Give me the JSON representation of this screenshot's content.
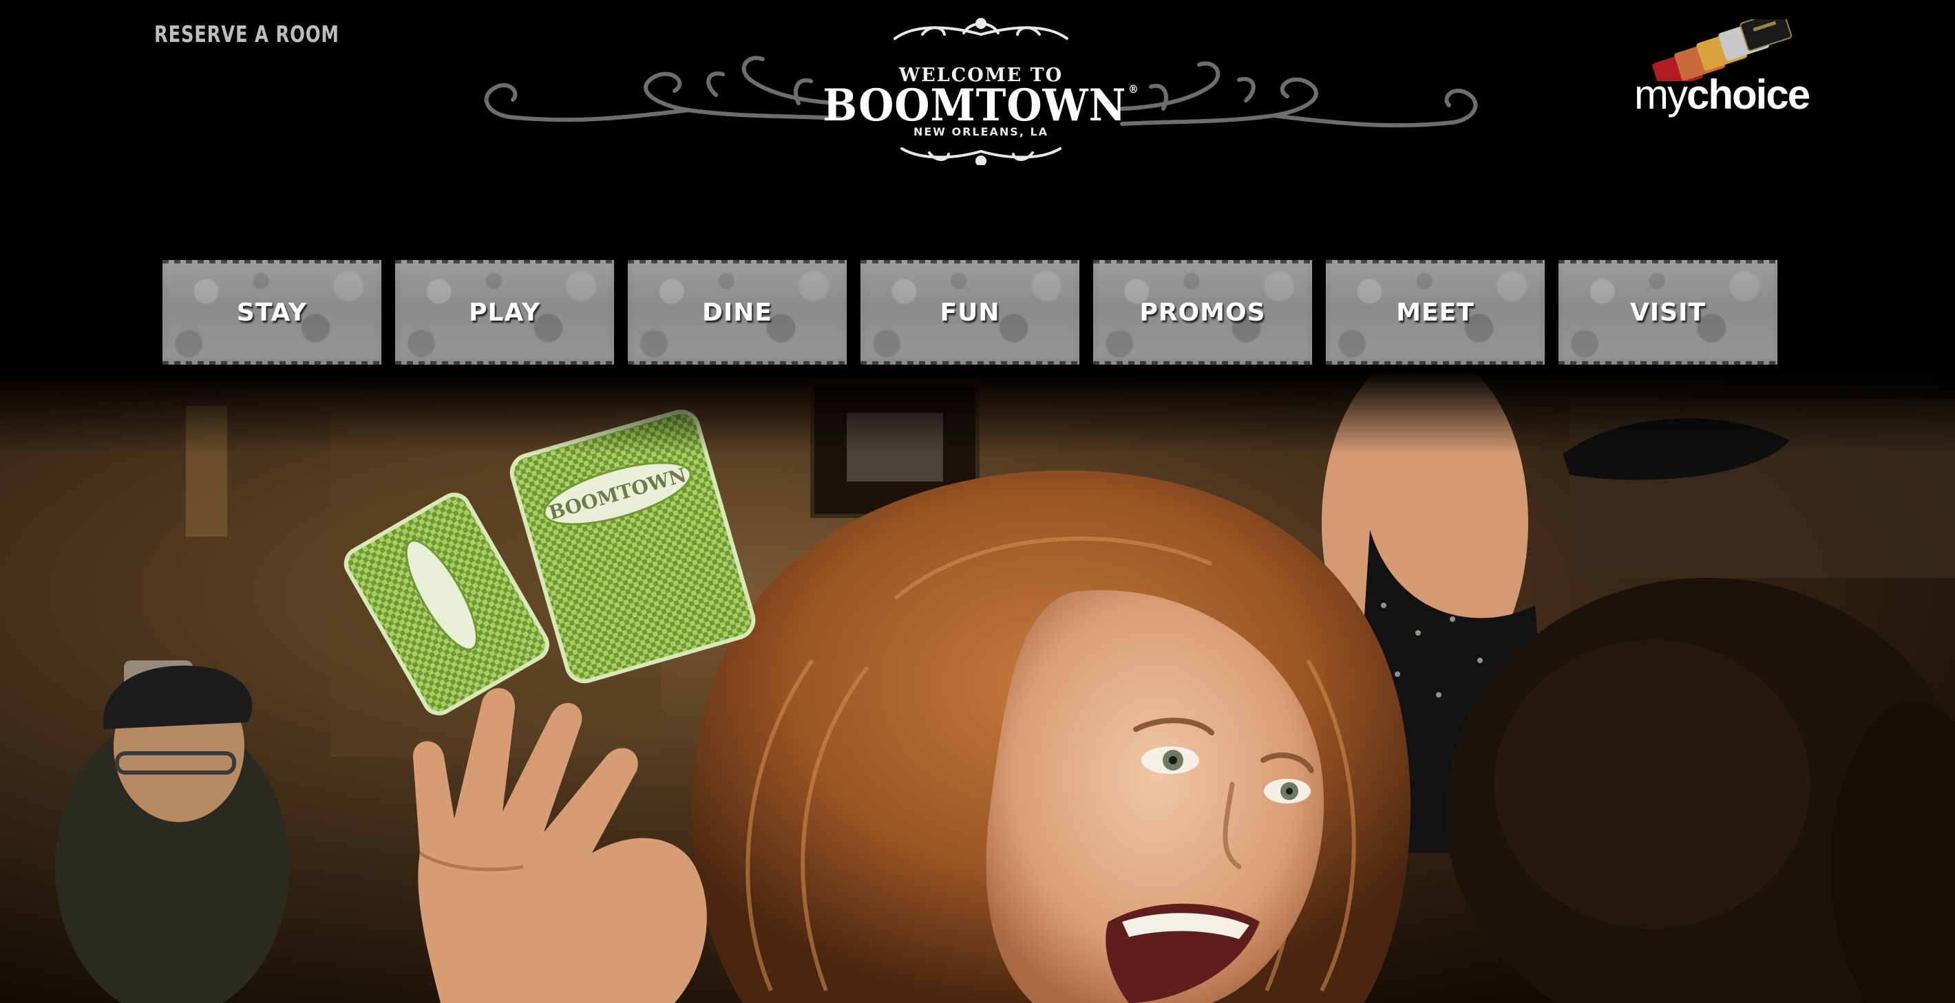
{
  "header": {
    "reserve_link": "RESERVE A ROOM",
    "brand": {
      "welcome": "WELCOME TO",
      "name": "BOOMTOWN",
      "registered": "®",
      "location": "NEW ORLEANS, LA"
    },
    "loyalty_logo": {
      "text_light": "my",
      "text_bold": "choice"
    }
  },
  "nav": {
    "items": [
      {
        "label": "STAY"
      },
      {
        "label": "PLAY"
      },
      {
        "label": "DINE"
      },
      {
        "label": "FUN"
      },
      {
        "label": "PROMOS"
      },
      {
        "label": "MEET"
      },
      {
        "label": "VISIT"
      }
    ]
  },
  "hero": {
    "card_brand": "BOOMTOWN"
  },
  "colors": {
    "background": "#000000",
    "nav_stone": "#929292",
    "header_link": "#bdbdbd",
    "card_green": "#8fbf4a",
    "hair": "#a25b26"
  }
}
